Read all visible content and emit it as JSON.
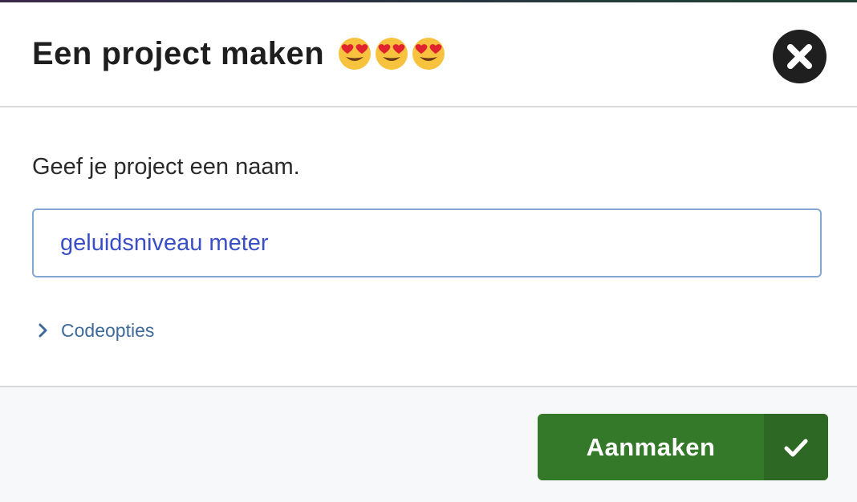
{
  "dialog": {
    "title": "Een project maken",
    "title_emojis": [
      "heart-eyes-emoji",
      "heart-eyes-emoji",
      "heart-eyes-emoji"
    ],
    "close_icon": "close-icon"
  },
  "form": {
    "prompt": "Geef je project een naam.",
    "project_name_value": "geluidsniveau meter",
    "code_options_label": "Codeopties",
    "code_options_icon": "chevron-right-icon"
  },
  "footer": {
    "create_label": "Aanmaken",
    "create_icon": "checkmark-icon"
  },
  "colors": {
    "primary_green": "#34782a",
    "input_text": "#3a4fc6",
    "link_blue": "#3e6a9b",
    "close_bg": "#1f1f1f"
  }
}
